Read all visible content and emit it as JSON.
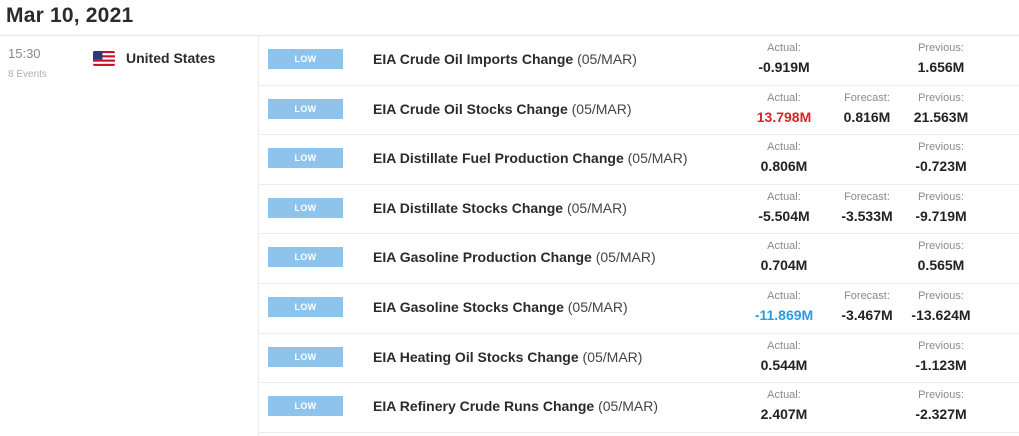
{
  "header": {
    "date": "Mar 10, 2021"
  },
  "group": {
    "time": "15:30",
    "events_count": "8 Events",
    "country": "United States",
    "flag_icon": "us-flag-icon"
  },
  "labels": {
    "actual": "Actual:",
    "forecast": "Forecast:",
    "previous": "Previous:"
  },
  "colors": {
    "impact_low": "#8ec3ec",
    "actual_miss": "#d8232a",
    "actual_beat": "#2b9be0"
  },
  "events": [
    {
      "impact": "LOW",
      "name": "EIA Crude Oil Imports Change",
      "period": "(05/MAR)",
      "actual": "-0.919M",
      "forecast": "",
      "previous": "1.656M",
      "highlight": ""
    },
    {
      "impact": "LOW",
      "name": "EIA Crude Oil Stocks Change",
      "period": "(05/MAR)",
      "actual": "13.798M",
      "forecast": "0.816M",
      "previous": "21.563M",
      "highlight": "red"
    },
    {
      "impact": "LOW",
      "name": "EIA Distillate Fuel Production Change",
      "period": "(05/MAR)",
      "actual": "0.806M",
      "forecast": "",
      "previous": "-0.723M",
      "highlight": ""
    },
    {
      "impact": "LOW",
      "name": "EIA Distillate Stocks Change",
      "period": "(05/MAR)",
      "actual": "-5.504M",
      "forecast": "-3.533M",
      "previous": "-9.719M",
      "highlight": ""
    },
    {
      "impact": "LOW",
      "name": "EIA Gasoline Production Change",
      "period": "(05/MAR)",
      "actual": "0.704M",
      "forecast": "",
      "previous": "0.565M",
      "highlight": ""
    },
    {
      "impact": "LOW",
      "name": "EIA Gasoline Stocks Change",
      "period": "(05/MAR)",
      "actual": "-11.869M",
      "forecast": "-3.467M",
      "previous": "-13.624M",
      "highlight": "blue"
    },
    {
      "impact": "LOW",
      "name": "EIA Heating Oil Stocks Change",
      "period": "(05/MAR)",
      "actual": "0.544M",
      "forecast": "",
      "previous": "-1.123M",
      "highlight": ""
    },
    {
      "impact": "LOW",
      "name": "EIA Refinery Crude Runs Change",
      "period": "(05/MAR)",
      "actual": "2.407M",
      "forecast": "",
      "previous": "-2.327M",
      "highlight": ""
    }
  ]
}
